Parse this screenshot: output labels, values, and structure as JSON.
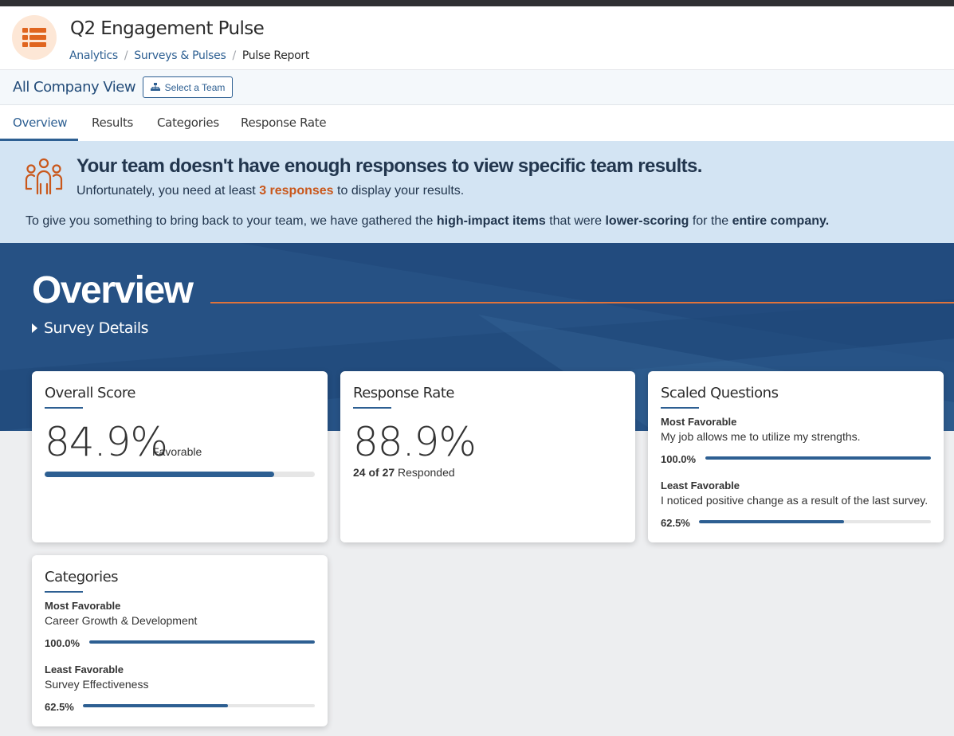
{
  "header": {
    "title": "Q2 Engagement Pulse",
    "breadcrumb": [
      "Analytics",
      "Surveys & Pulses",
      "Pulse Report"
    ],
    "icon": "list-report-icon"
  },
  "viewbar": {
    "title": "All Company View",
    "team_button": "Select a Team"
  },
  "tabs": [
    {
      "label": "Overview",
      "active": true
    },
    {
      "label": "Results"
    },
    {
      "label": "Categories"
    },
    {
      "label": "Response Rate"
    }
  ],
  "alert": {
    "title": "Your team doesn't have enough responses to view specific team results.",
    "sub_prefix": "Unfortunately, you need at least ",
    "sub_highlight": "3 responses",
    "sub_suffix": " to display your results.",
    "line_1": "To give you something to bring back to your team, we have gathered the ",
    "line_b1": "high-impact items",
    "line_2": " that were ",
    "line_b2": "lower-scoring",
    "line_3": " for the ",
    "line_b3": "entire company."
  },
  "hero": {
    "title": "Overview",
    "details_label": "Survey Details"
  },
  "overall": {
    "title": "Overall Score",
    "value": "84.9%",
    "suffix": "Favorable",
    "fraction": 0.849
  },
  "response": {
    "title": "Response Rate",
    "value": "88.9%",
    "count": "24 of 27",
    "suffix": " Responded"
  },
  "scaled": {
    "title": "Scaled Questions",
    "most_label": "Most Favorable",
    "most_text": "My job allows me to utilize my strengths.",
    "most_pct": "100.0%",
    "most_fraction": 1.0,
    "least_label": "Least Favorable",
    "least_text": "I noticed positive change as a result of the last survey.",
    "least_pct": "62.5%",
    "least_fraction": 0.625
  },
  "categories": {
    "title": "Categories",
    "most_label": "Most Favorable",
    "most_text": "Career Growth & Development",
    "most_pct": "100.0%",
    "most_fraction": 1.0,
    "least_label": "Least Favorable",
    "least_text": "Survey Effectiveness",
    "least_pct": "62.5%",
    "least_fraction": 0.625
  },
  "colors": {
    "brand": "#2d5f92",
    "accent": "#c9571b",
    "hero": "#224c7e"
  }
}
